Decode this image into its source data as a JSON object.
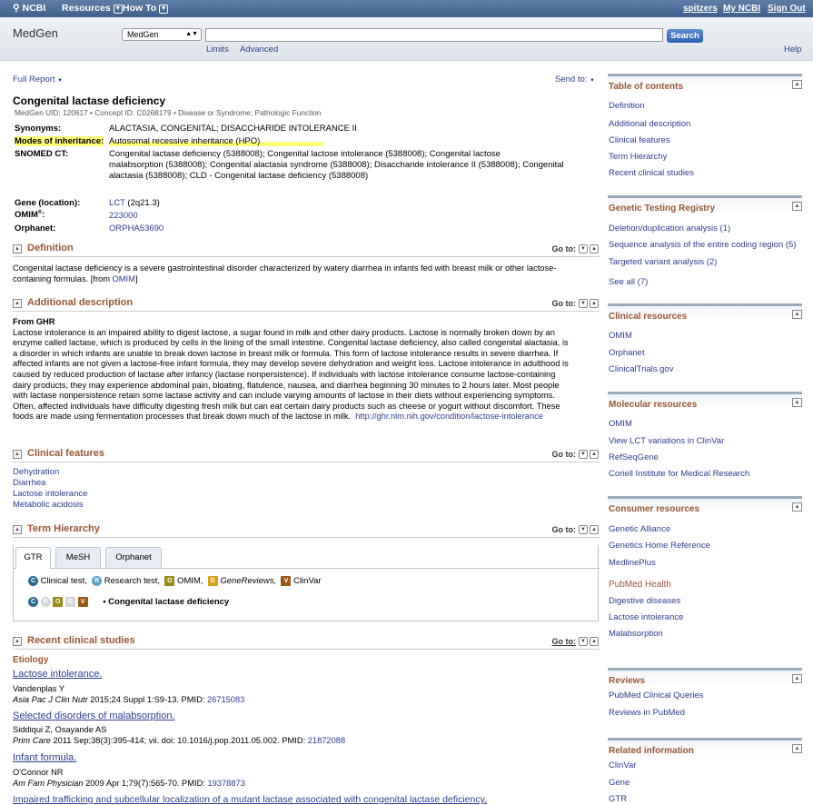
{
  "topbar": {
    "logo": "NCBI",
    "resources": "Resources",
    "howto": "How To",
    "user": "spitzers",
    "myncbi": "My NCBI",
    "signout": "Sign Out"
  },
  "search": {
    "db_title": "MedGen",
    "db_selected": "MedGen",
    "query": "",
    "button": "Search",
    "limits": "Limits",
    "advanced": "Advanced",
    "help": "Help"
  },
  "report": {
    "format": "Full Report",
    "sendto": "Send to:"
  },
  "record": {
    "title": "Congenital lactase deficiency",
    "uid_line": "MedGen UID: 120617 • Concept ID: C0268179 • Disease or Syndrome; Pathologic Function",
    "synonyms_label": "Synonyms:",
    "synonyms": "ALACTASIA, CONGENITAL; DISACCHARIDE INTOLERANCE II",
    "modes_label": "Modes of inheritance:",
    "modes": "Autosomal recessive inheritance (HPO)",
    "snomed_label": "SNOMED CT:",
    "snomed_1": "Congenital lactase deficiency (5388008); Congenital lactose intolerance (5388008); Congenital lactose",
    "snomed_2": "malabsorption (5388008); Congenital alactasia syndrome (5388008); Disaccharide intolerance II (5388008); Congenital",
    "snomed_3": "alactasia (5388008); CLD - Congenital lactase deficiency (5388008)",
    "gene_label": "Gene (location):",
    "gene": "LCT",
    "gene_loc": "(2q21.3)",
    "omim_label": "OMIM",
    "omim_sup": "®",
    "omim_colon": ":",
    "omim": "223000",
    "orphanet_label": "Orphanet:",
    "orphanet": "ORPHA53690"
  },
  "goto": "Go to:",
  "sections": {
    "definition": "Definition",
    "additional": "Additional description",
    "clinical": "Clinical features",
    "term": "Term Hierarchy",
    "recent": "Recent clinical studies"
  },
  "definition": {
    "line1": "Congenital lactase deficiency is a severe gastrointestinal disorder characterized by watery diarrhea in infants fed with breast milk or other lactose-",
    "line2a": "containing formulas. [from ",
    "line2b": "OMIM",
    "line2c": "]"
  },
  "additional": {
    "from": "From GHR",
    "lines": [
      "Lactose intolerance is an impaired ability to digest lactose, a sugar found in milk and other dairy products. Lactose is normally broken down by an",
      "enzyme called lactase, which is produced by cells in the lining of the small intestine. Congenital lactase deficiency, also called congenital alactasia, is",
      "a disorder in which infants are unable to break down lactose in breast milk or formula. This form of lactose intolerance results in severe diarrhea. If",
      "affected infants are not given a lactose-free infant formula, they may develop severe dehydration and weight loss. Lactose intolerance in adulthood is",
      "caused by reduced production of lactase after infancy (lactase nonpersistence). If individuals with lactose intolerance consume lactose-containing",
      "dairy products, they may experience abdominal pain, bloating, flatulence, nausea, and diarrhea beginning 30 minutes to 2 hours later. Most people",
      "with lactase nonpersistence retain some lactase activity and can include varying amounts of lactose in their diets without experiencing symptoms.",
      "Often, affected individuals have difficulty digesting fresh milk but can eat certain dairy products such as cheese or yogurt without discomfort. These"
    ],
    "last": "foods are made using fermentation processes that break down much of the lactose in milk.",
    "link": "http://ghr.nlm.nih.gov/condition/lactose-intolerance"
  },
  "clinical_features": [
    "Dehydration",
    "Diarrhea",
    "Lactose intolerance",
    "Metabolic acidosis"
  ],
  "term": {
    "tabs": [
      "GTR",
      "MeSH",
      "Orphanet"
    ],
    "legend": [
      {
        "badge": "C",
        "text": "Clinical test,"
      },
      {
        "badge": "R",
        "text": "Research test,"
      },
      {
        "badge": "O",
        "text": "OMIM,"
      },
      {
        "badge": "G",
        "text": "GeneReviews,"
      },
      {
        "badge": "V",
        "text": "ClinVar"
      }
    ],
    "row_badges": [
      "C",
      "R",
      "O",
      "G",
      "V"
    ],
    "node": "Congenital lactase deficiency",
    "colors": {
      "C": "#2a6c8e",
      "R": "#5aa0c8",
      "O": "#9a8a16",
      "G": "#d8a01f",
      "V": "#9a5a16",
      "off": "#d6d6d6"
    }
  },
  "studies": {
    "heading": "Etiology",
    "items": [
      {
        "title": "Lactose intolerance.",
        "author": "Vandenplas Y",
        "journal": "Asia Pac J Clin Nutr",
        "cite": "2015;24 Suppl 1:S9-13. PMID: ",
        "pmid": "26715083"
      },
      {
        "title": "Selected disorders of malabsorption.",
        "author": "Siddiqui Z, Osayande AS",
        "journal": "Prim Care",
        "cite": "2011 Sep;38(3):395-414; vii. doi: 10.1016/j.pop.2011.05.002. PMID: ",
        "pmid": "21872088"
      },
      {
        "title": "Infant formula.",
        "author": "O'Connor NR",
        "journal": "Am Fam Physician",
        "cite": "2009 Apr 1;79(7):565-70. PMID: ",
        "pmid": "19378873"
      },
      {
        "title": "Impaired trafficking and subcellular localization of a mutant lactase associated with congenital lactase deficiency."
      }
    ]
  },
  "right": {
    "toc": {
      "title": "Table of contents",
      "items": [
        "Definition",
        "Additional description",
        "Clinical features",
        "Term Hierarchy",
        "Recent clinical studies"
      ]
    },
    "gtr": {
      "title": "Genetic Testing Registry",
      "items": [
        "Deletion/duplication analysis (1)",
        "Sequence analysis of the entire coding region (5)",
        "Targeted variant analysis (2)"
      ],
      "seeall": "See all (7)"
    },
    "clinical": {
      "title": "Clinical resources",
      "items": [
        "OMIM",
        "Orphanet",
        "ClinicalTrials.gov"
      ]
    },
    "molecular": {
      "title": "Molecular resources",
      "items": [
        "OMIM",
        "View LCT variations in ClinVar",
        "RefSeqGene",
        "Coriell Institute for Medical Research"
      ]
    },
    "consumer": {
      "title": "Consumer resources",
      "items": [
        "Genetic Alliance",
        "Genetics Home Reference",
        "MedlinePlus"
      ],
      "pmh_title": "PubMed Health",
      "pmh_items": [
        "Digestive diseases",
        "Lactose intolerance",
        "Malabsorption"
      ]
    },
    "reviews": {
      "title": "Reviews",
      "items": [
        "PubMed Clinical Queries",
        "Reviews in PubMed"
      ]
    },
    "related": {
      "title": "Related information",
      "items": [
        "ClinVar",
        "Gene",
        "GTR"
      ]
    }
  }
}
